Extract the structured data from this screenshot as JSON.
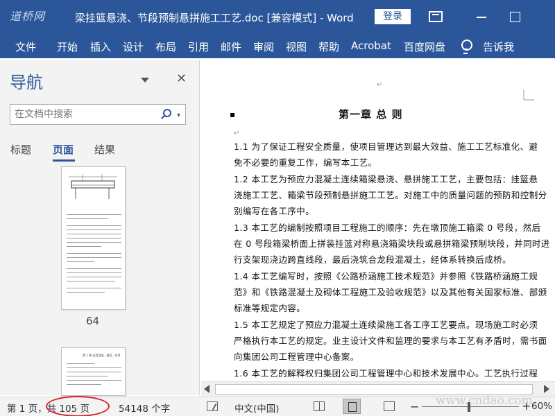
{
  "window": {
    "brand": "道桥网",
    "title": "梁挂篮悬浇、节段预制悬拼施工工艺.doc [兼容模式]  -  Word",
    "login_label": "登录"
  },
  "menu": {
    "tabs": [
      "文件",
      "开始",
      "插入",
      "设计",
      "布局",
      "引用",
      "邮件",
      "审阅",
      "视图",
      "帮助",
      "Acrobat",
      "百度网盘"
    ],
    "tell_me": "告诉我"
  },
  "nav": {
    "title": "导航",
    "search_placeholder": "在文档中搜索",
    "tabs": [
      "标题",
      "页面",
      "结果"
    ],
    "active_tab": "页面",
    "page_number": "64",
    "thumb2_heading": "第 1 章  适用范围、规范、作用"
  },
  "document": {
    "chapter_title": "第一章    总  则",
    "lines": [
      "1.1  为了保证工程安全质量，使项目管理达到最大效益、施工工艺标准化、避",
      "免不必要的重复工作，编写本工艺。",
      "1.2  本工艺为预应力混凝土连续箱梁悬浇、悬拼施工工艺，主要包括：挂篮悬",
      "浇施工工艺、箱梁节段预制悬拼施工工艺。对施工中的质量问题的预防和控制分",
      "别编写在各工序中。",
      "1.3  本工艺的编制按照项目工程施工的顺序：先在墩顶施工箱梁 0 号段，然后",
      "在 0 号段箱梁桥面上拼装挂篮对称悬浇箱梁块段或悬拼箱梁预制块段，并同时进",
      "行支架现浇边跨直线段，最后浇筑合龙段混凝土，经体系转换后成桥。",
      "1.4  本工艺编写时，按照《公路桥涵施工技术规范》并参照《铁路桥涵施工规",
      "范》和《铁路混凝土及砌体工程施工及验收规范》以及其他有关国家标准、部颁",
      "标准等规定内容。",
      "1.5  本工艺规定了预应力混凝土连续梁施工各工序工艺要点。现场施工时必须",
      "严格执行本工艺的规定。业主设计文件和监理的要求与本工艺有矛盾时，需书面",
      "向集团公司工程管理中心备案。",
      "1.6  本工艺的解释权归集团公司工程管理中心和技术发展中心。工艺执行过程"
    ]
  },
  "status": {
    "page_info": "第 1 页，共 105 页",
    "word_count": "54148 个字",
    "language": "中文(中国)",
    "zoom": "60%",
    "watermark": "www.cndao.com"
  },
  "colors": {
    "accent": "#2b579a",
    "highlight_circle": "#d4202c"
  }
}
